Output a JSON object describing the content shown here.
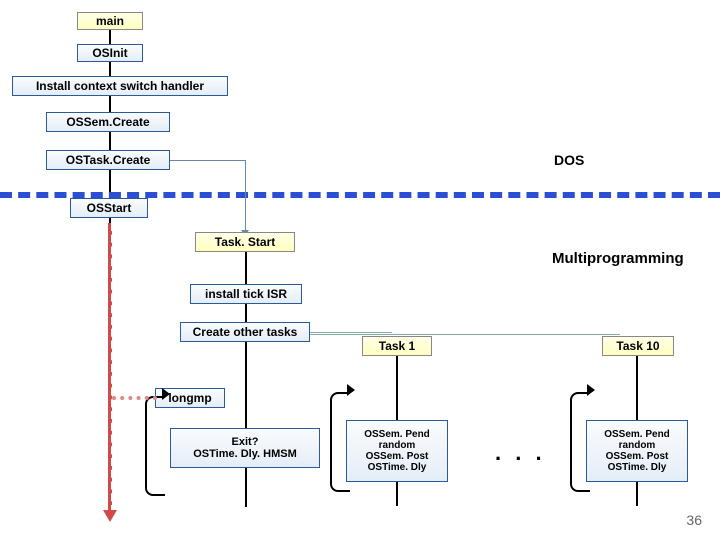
{
  "boxes": {
    "main": "main",
    "osinit": "OSInit",
    "install_ctx": "Install context switch handler",
    "ossemcreate": "OSSem.Create",
    "ostaskcreate": "OSTask.Create",
    "osstart": "OSStart",
    "taskstart": "Task. Start",
    "install_tick": "install tick ISR",
    "create_other": "Create other tasks",
    "task1": "Task 1",
    "task10": "Task 10",
    "longmp": "longmp",
    "exit": "Exit?\nOSTime. Dly. HMSM",
    "loop1": "OSSem. Pend\nrandom\nOSSem. Post\nOSTime. Dly",
    "loop10": "OSSem. Pend\nrandom\nOSSem. Post\nOSTime. Dly"
  },
  "labels": {
    "dos": "DOS",
    "multi": "Multiprogramming",
    "dots": ". . ."
  },
  "page": "36"
}
